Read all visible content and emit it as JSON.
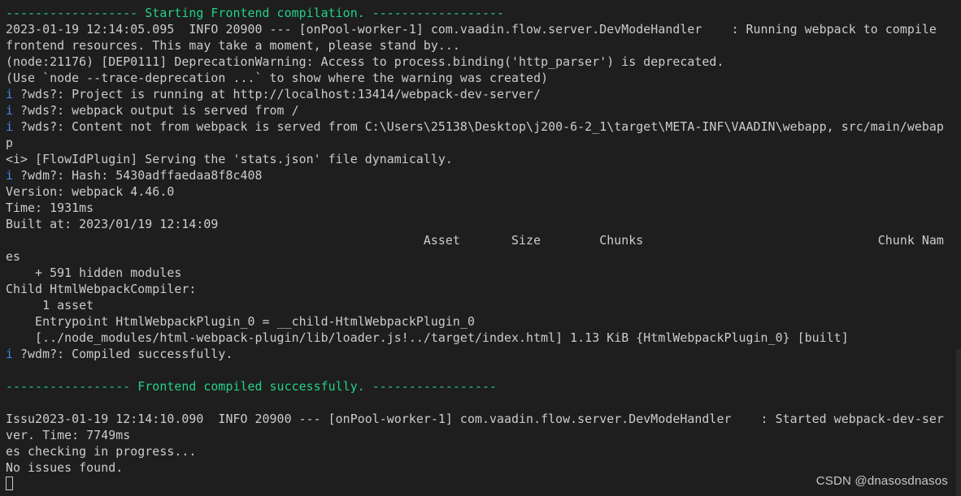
{
  "terminal": {
    "lines": [
      {
        "segments": [
          {
            "text": "------------------ Starting Frontend compilation. ------------------",
            "color": "green"
          }
        ]
      },
      {
        "segments": [
          {
            "text": "2023-01-19 12:14:05.095  INFO 20900 --- [onPool-worker-1] com.vaadin.flow.server.DevModeHandler    : Running webpack to compile",
            "color": "default"
          }
        ]
      },
      {
        "segments": [
          {
            "text": "frontend resources. This may take a moment, please stand by...",
            "color": "default"
          }
        ]
      },
      {
        "segments": [
          {
            "text": "(node:21176) [DEP0111] DeprecationWarning: Access to process.binding('http_parser') is deprecated.",
            "color": "default"
          }
        ]
      },
      {
        "segments": [
          {
            "text": "(Use `node --trace-deprecation ...` to show where the warning was created)",
            "color": "default"
          }
        ]
      },
      {
        "segments": [
          {
            "text": "i ",
            "color": "blue"
          },
          {
            "text": "?wds?: Project is running at http://localhost:13414/webpack-dev-server/",
            "color": "default"
          }
        ]
      },
      {
        "segments": [
          {
            "text": "i ",
            "color": "blue"
          },
          {
            "text": "?wds?: webpack output is served from /",
            "color": "default"
          }
        ]
      },
      {
        "segments": [
          {
            "text": "i ",
            "color": "blue"
          },
          {
            "text": "?wds?: Content not from webpack is served from C:\\Users\\25138\\Desktop\\j200-6-2_1\\target\\META-INF\\VAADIN\\webapp, src/main/webap",
            "color": "default"
          }
        ]
      },
      {
        "segments": [
          {
            "text": "p",
            "color": "default"
          }
        ]
      },
      {
        "segments": [
          {
            "text": "<i> [FlowIdPlugin] Serving the 'stats.json' file dynamically.",
            "color": "default"
          }
        ]
      },
      {
        "segments": [
          {
            "text": "i ",
            "color": "blue"
          },
          {
            "text": "?wdm?: Hash: 5430adffaedaa8f8c408",
            "color": "default"
          }
        ]
      },
      {
        "segments": [
          {
            "text": "Version: webpack 4.46.0",
            "color": "default"
          }
        ]
      },
      {
        "segments": [
          {
            "text": "Time: 1931ms",
            "color": "default"
          }
        ]
      },
      {
        "segments": [
          {
            "text": "Built at: 2023/01/19 12:14:09",
            "color": "default"
          }
        ]
      },
      {
        "segments": [
          {
            "text": "                                                         Asset       Size        Chunks                                Chunk Nam",
            "color": "default"
          }
        ]
      },
      {
        "segments": [
          {
            "text": "es",
            "color": "default"
          }
        ]
      },
      {
        "segments": [
          {
            "text": "    + 591 hidden modules",
            "color": "default"
          }
        ]
      },
      {
        "segments": [
          {
            "text": "Child HtmlWebpackCompiler:",
            "color": "default"
          }
        ]
      },
      {
        "segments": [
          {
            "text": "     1 asset",
            "color": "default"
          }
        ]
      },
      {
        "segments": [
          {
            "text": "    Entrypoint HtmlWebpackPlugin_0 = __child-HtmlWebpackPlugin_0",
            "color": "default"
          }
        ]
      },
      {
        "segments": [
          {
            "text": "    [../node_modules/html-webpack-plugin/lib/loader.js!../target/index.html] 1.13 KiB {HtmlWebpackPlugin_0} [built]",
            "color": "default"
          }
        ]
      },
      {
        "segments": [
          {
            "text": "i ",
            "color": "blue"
          },
          {
            "text": "?wdm?: Compiled successfully.",
            "color": "default"
          }
        ]
      },
      {
        "segments": [
          {
            "text": "",
            "color": "default"
          }
        ]
      },
      {
        "segments": [
          {
            "text": "----------------- Frontend compiled successfully. -----------------",
            "color": "green"
          }
        ]
      },
      {
        "segments": [
          {
            "text": "",
            "color": "default"
          }
        ]
      },
      {
        "segments": [
          {
            "text": "Issu2023-01-19 12:14:10.090  INFO 20900 --- [onPool-worker-1] com.vaadin.flow.server.DevModeHandler    : Started webpack-dev-ser",
            "color": "default"
          }
        ]
      },
      {
        "segments": [
          {
            "text": "ver. Time: 7749ms",
            "color": "default"
          }
        ]
      },
      {
        "segments": [
          {
            "text": "es checking in progress...",
            "color": "default"
          }
        ]
      },
      {
        "segments": [
          {
            "text": "No issues found.",
            "color": "default"
          }
        ]
      }
    ]
  },
  "watermark": "CSDN @dnasosdnasos",
  "colors": {
    "background": "#1e1e1e",
    "default": "#cccccc",
    "green": "#23d18b",
    "blue": "#3b8eea"
  }
}
